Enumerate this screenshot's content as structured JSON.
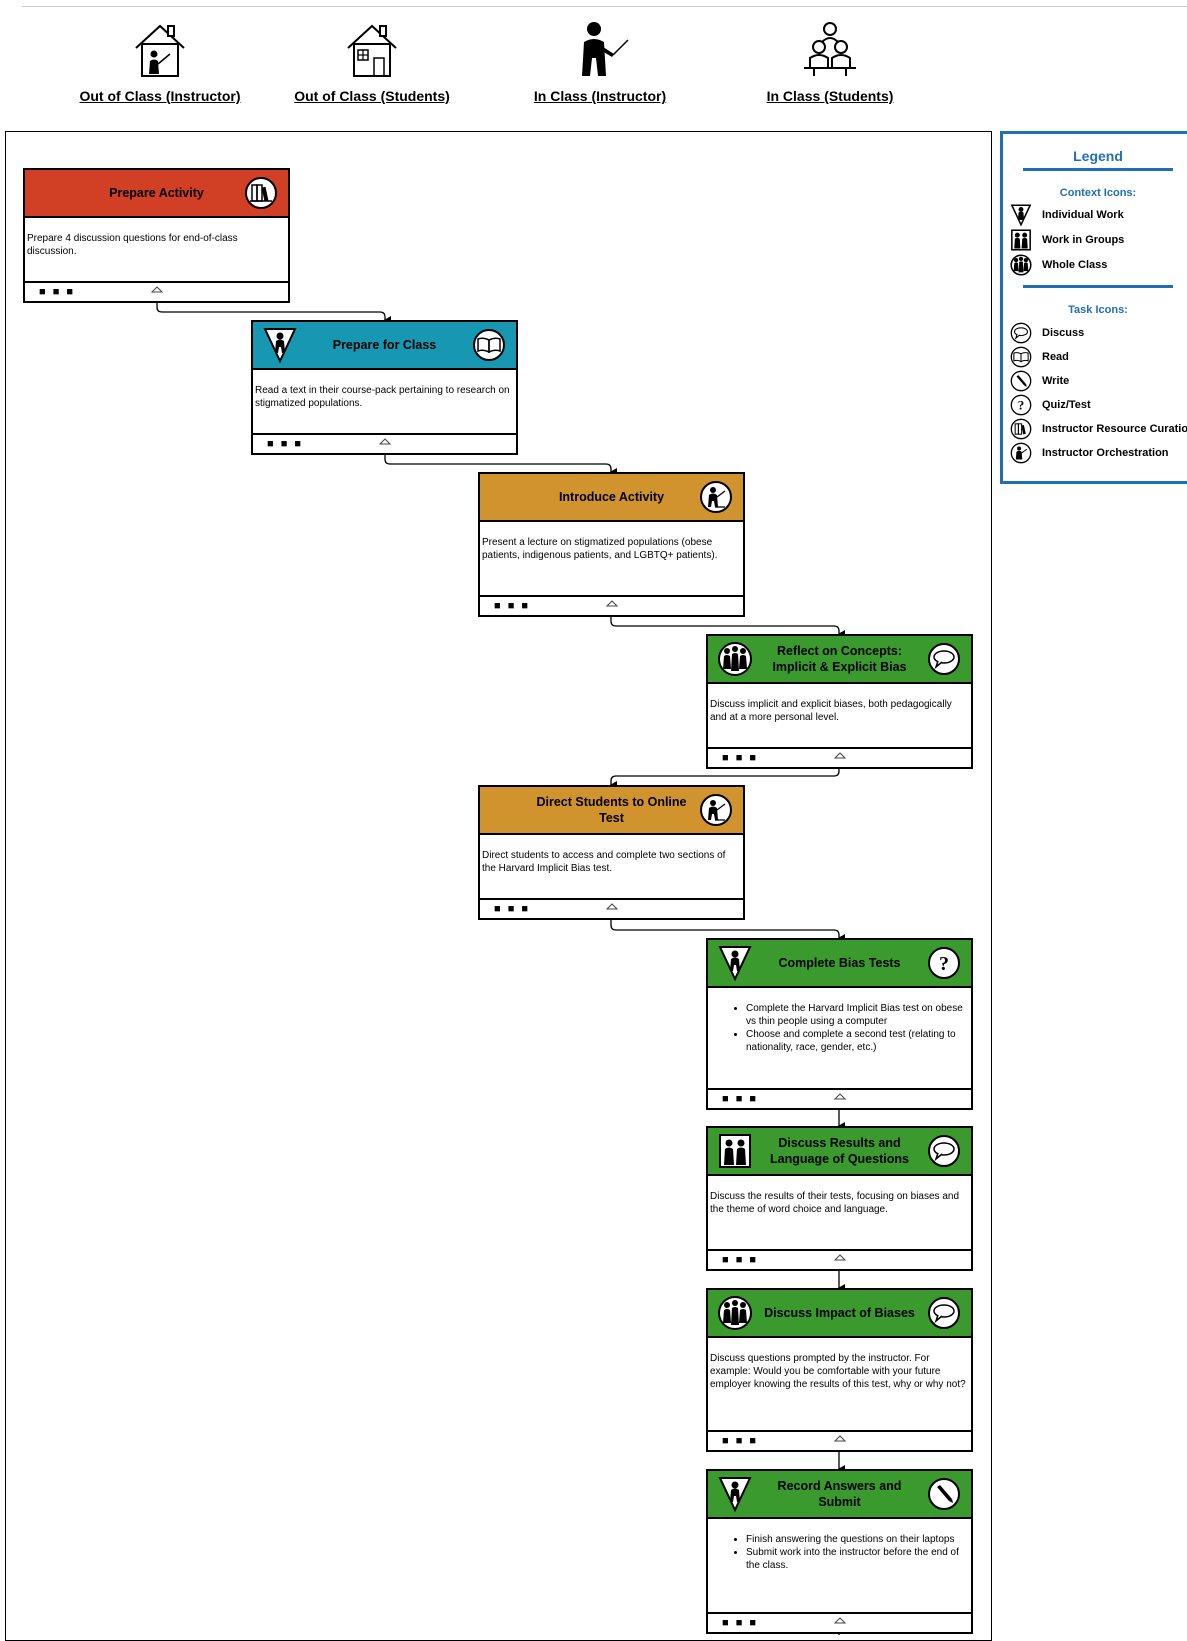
{
  "columns": [
    {
      "label": "Out of Class (Instructor)",
      "icon": "house-instructor-icon"
    },
    {
      "label": "Out of Class (Students)",
      "icon": "house-student-icon"
    },
    {
      "label": "In Class (Instructor)",
      "icon": "instructor-pointer-icon"
    },
    {
      "label": "In Class (Students)",
      "icon": "students-group-icon"
    }
  ],
  "colors": {
    "out_of_class_instructor": "#d13f24",
    "out_of_class_students": "#1797b1",
    "in_class_instructor": "#d1932e",
    "in_class_students": "#3a9a2e",
    "legend_accent": "#1f6fb5"
  },
  "legend": {
    "title": "Legend",
    "context_heading": "Context Icons:",
    "context_items": [
      {
        "label": "Individual Work",
        "icon": "individual-work-icon"
      },
      {
        "label": "Work in Groups",
        "icon": "work-in-groups-icon"
      },
      {
        "label": "Whole Class",
        "icon": "whole-class-icon"
      }
    ],
    "task_heading": "Task Icons:",
    "task_items": [
      {
        "label": "Discuss",
        "icon": "discuss-icon"
      },
      {
        "label": "Read",
        "icon": "read-icon"
      },
      {
        "label": "Write",
        "icon": "write-icon"
      },
      {
        "label": "Quiz/Test",
        "icon": "quiz-icon"
      },
      {
        "label": "Instructor Resource Curation",
        "icon": "resource-curation-icon"
      },
      {
        "label": "Instructor Orchestration",
        "icon": "orchestration-icon"
      }
    ]
  },
  "footer": {
    "dots": "■ ■ ■"
  },
  "activities": [
    {
      "title": "Prepare Activity",
      "context_icon": "",
      "task_icon": "resource-curation-icon",
      "body": "Prepare 4 discussion questions for end-of-class discussion."
    },
    {
      "title": "Prepare for Class",
      "context_icon": "individual-work-icon",
      "task_icon": "read-icon",
      "body": "Read a text in their course-pack pertaining to research on stigmatized populations."
    },
    {
      "title": "Introduce Activity",
      "context_icon": "",
      "task_icon": "orchestration-icon",
      "body": "Present a lecture on stigmatized populations (obese patients, indigenous patients, and LGBTQ+ patients)."
    },
    {
      "title": "Reflect on Concepts: Implicit & Explicit Bias",
      "context_icon": "whole-class-icon",
      "task_icon": "discuss-icon",
      "body": "Discuss implicit and explicit biases, both pedagogically and at a more personal level."
    },
    {
      "title": "Direct Students to Online Test",
      "context_icon": "",
      "task_icon": "orchestration-icon",
      "body": "Direct students to access and complete two sections of the Harvard Implicit Bias test."
    },
    {
      "title": "Complete Bias Tests",
      "context_icon": "individual-work-icon",
      "task_icon": "quiz-icon",
      "bullets": [
        "Complete the Harvard Implicit Bias test on obese vs thin people using a computer",
        "Choose and complete a second test (relating to nationality, race, gender, etc.)"
      ]
    },
    {
      "title": "Discuss Results and Language of Questions",
      "context_icon": "work-in-groups-icon",
      "task_icon": "discuss-icon",
      "body": "Discuss the results of their tests, focusing on biases and the theme of word choice and language."
    },
    {
      "title": "Discuss Impact of Biases",
      "context_icon": "whole-class-icon",
      "task_icon": "discuss-icon",
      "body": "Discuss questions prompted by the instructor. For example: Would you be comfortable with your future employer knowing the results of this test, why or why not?"
    },
    {
      "title": "Record Answers and Submit",
      "context_icon": "individual-work-icon",
      "task_icon": "write-icon",
      "bullets": [
        "Finish answering the questions on their laptops",
        "Submit work into the instructor before the end of the class."
      ]
    }
  ]
}
